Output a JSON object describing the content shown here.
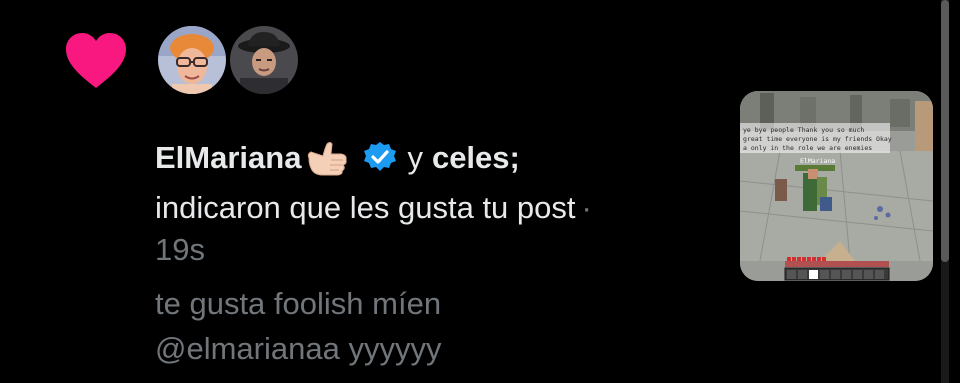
{
  "notification": {
    "type_icon": "heart-icon",
    "accent_color": "#f91880",
    "verified_color": "#1d9bf0",
    "user1": {
      "name": "ElMariana",
      "emoji": "call-me-hand-emoji",
      "verified": true,
      "avatar": "avatar-man-glasses-orange-hair"
    },
    "conjunction": "y",
    "user2": {
      "name": "celes;",
      "avatar": "avatar-man-cowboy-hat"
    },
    "action_text": "indicaron que les gusta tu post",
    "separator": "·",
    "time": "19s",
    "post_text_line1": "te gusta foolish míen",
    "post_text_line2": "@elmarianaa yyyyyy",
    "thumbnail": {
      "description_icon": "minecraft-screenshot-thumbnail",
      "chat_line1": "ye bye people Thank you so much",
      "chat_line2": "great time everyone is my friends Okay",
      "chat_line3": "a only in the role we are enemies",
      "nametag": "ElMariana"
    }
  }
}
